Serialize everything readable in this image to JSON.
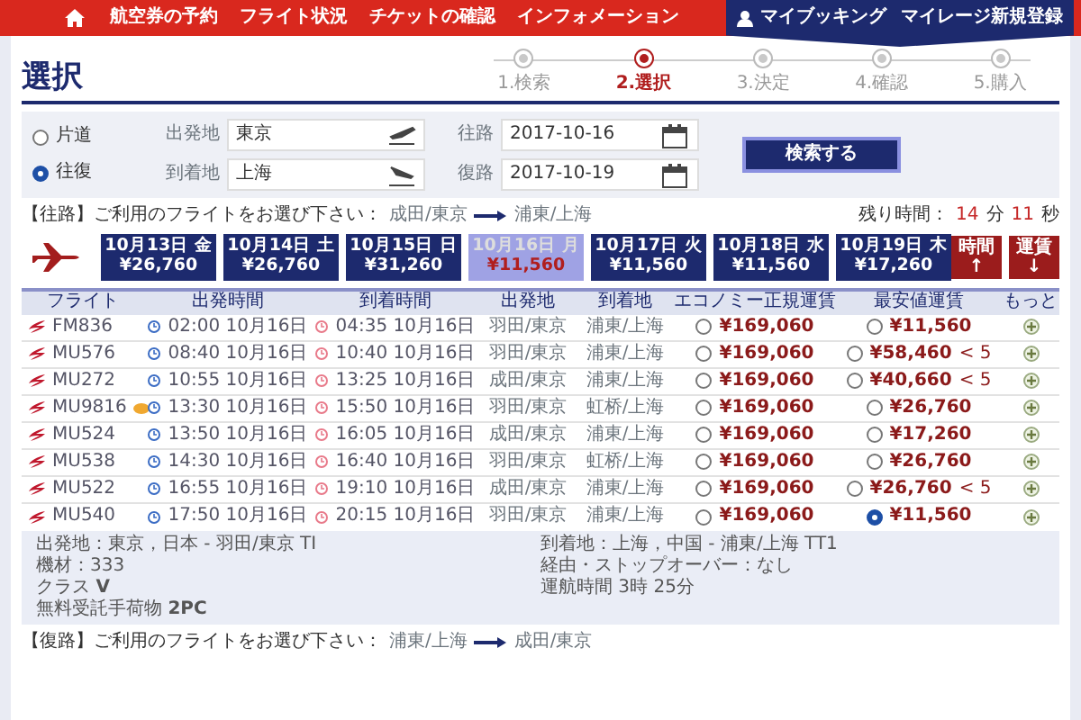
{
  "nav": {
    "items": [
      "航空券の予約",
      "フライト状況",
      "チケットの確認",
      "インフォメーション"
    ],
    "account": "マイブッキング",
    "register": "マイレージ新規登録"
  },
  "page_title": "選択",
  "steps": [
    {
      "label": "1.検索",
      "selected": false
    },
    {
      "label": "2.選択",
      "selected": true
    },
    {
      "label": "3.決定",
      "selected": false
    },
    {
      "label": "4.確認",
      "selected": false
    },
    {
      "label": "5.購入",
      "selected": false
    }
  ],
  "search": {
    "trip_types": [
      {
        "label": "片道",
        "selected": false
      },
      {
        "label": "往復",
        "selected": true
      }
    ],
    "fields": [
      {
        "label": "出発地",
        "value": "東京",
        "kind": "takeoff"
      },
      {
        "label": "往路",
        "value": "2017-10-16",
        "kind": "date"
      },
      {
        "label": "到着地",
        "value": "上海",
        "kind": "landing"
      },
      {
        "label": "復路",
        "value": "2017-10-19",
        "kind": "date"
      }
    ],
    "button": "検索する"
  },
  "outbound": {
    "prompt": "【往路】ご利用のフライトをお選び下さい：",
    "from": "成田/東京",
    "to": "浦東/上海",
    "remaining_label": "残り時間：",
    "minutes": "14",
    "minutes_unit": "分",
    "seconds": "11",
    "seconds_unit": "秒"
  },
  "date_tabs": [
    {
      "date": "10月13日 金",
      "price": "¥26,760",
      "selected": false
    },
    {
      "date": "10月14日 土",
      "price": "¥26,760",
      "selected": false
    },
    {
      "date": "10月15日 日",
      "price": "¥31,260",
      "selected": false
    },
    {
      "date": "10月16日 月",
      "price": "¥11,560",
      "selected": true
    },
    {
      "date": "10月17日 火",
      "price": "¥11,560",
      "selected": false
    },
    {
      "date": "10月18日 水",
      "price": "¥11,560",
      "selected": false
    },
    {
      "date": "10月19日 木",
      "price": "¥17,260",
      "selected": false
    }
  ],
  "sort_buttons": [
    {
      "label": "時間",
      "arrow": "↑"
    },
    {
      "label": "運賃",
      "arrow": "↓"
    }
  ],
  "columns": [
    "フライト",
    "出発時間",
    "到着時間",
    "出発地",
    "到着地",
    "エコノミー正規運賃",
    "最安値運賃",
    "もっと"
  ],
  "rows": [
    {
      "flight": "FM836",
      "badge": false,
      "departs": "02:00 10月16日",
      "arrives": "04:35 10月16日",
      "from": "羽田/東京",
      "to": "浦東/上海",
      "economy": "¥169,060",
      "economy_selected": false,
      "lowest": "¥11,560",
      "seats": "",
      "lowest_selected": false,
      "expanded": false
    },
    {
      "flight": "MU576",
      "badge": false,
      "departs": "08:40 10月16日",
      "arrives": "10:40 10月16日",
      "from": "羽田/東京",
      "to": "浦東/上海",
      "economy": "¥169,060",
      "economy_selected": false,
      "lowest": "¥58,460",
      "seats": "< 5",
      "lowest_selected": false,
      "expanded": false
    },
    {
      "flight": "MU272",
      "badge": false,
      "departs": "10:55 10月16日",
      "arrives": "13:25 10月16日",
      "from": "成田/東京",
      "to": "浦東/上海",
      "economy": "¥169,060",
      "economy_selected": false,
      "lowest": "¥40,660",
      "seats": "< 5",
      "lowest_selected": false,
      "expanded": false
    },
    {
      "flight": "MU9816",
      "badge": true,
      "departs": "13:30 10月16日",
      "arrives": "15:50 10月16日",
      "from": "羽田/東京",
      "to": "虹桥/上海",
      "economy": "¥169,060",
      "economy_selected": false,
      "lowest": "¥26,760",
      "seats": "",
      "lowest_selected": false,
      "expanded": false
    },
    {
      "flight": "MU524",
      "badge": false,
      "departs": "13:50 10月16日",
      "arrives": "16:05 10月16日",
      "from": "成田/東京",
      "to": "浦東/上海",
      "economy": "¥169,060",
      "economy_selected": false,
      "lowest": "¥17,260",
      "seats": "",
      "lowest_selected": false,
      "expanded": false
    },
    {
      "flight": "MU538",
      "badge": false,
      "departs": "14:30 10月16日",
      "arrives": "16:40 10月16日",
      "from": "羽田/東京",
      "to": "虹桥/上海",
      "economy": "¥169,060",
      "economy_selected": false,
      "lowest": "¥26,760",
      "seats": "",
      "lowest_selected": false,
      "expanded": false
    },
    {
      "flight": "MU522",
      "badge": false,
      "departs": "16:55 10月16日",
      "arrives": "19:10 10月16日",
      "from": "成田/東京",
      "to": "浦東/上海",
      "economy": "¥169,060",
      "economy_selected": false,
      "lowest": "¥26,760",
      "seats": "< 5",
      "lowest_selected": false,
      "expanded": false
    },
    {
      "flight": "MU540",
      "badge": false,
      "departs": "17:50 10月16日",
      "arrives": "20:15 10月16日",
      "from": "羽田/東京",
      "to": "浦東/上海",
      "economy": "¥169,060",
      "economy_selected": false,
      "lowest": "¥11,560",
      "seats": "",
      "lowest_selected": true,
      "expanded": true,
      "details": {
        "left": [
          "出発地：東京，日本 - 羽田/東京 TI",
          "機材：333",
          "クラス **V**",
          "無料受託手荷物 **2PC**"
        ],
        "right": [
          "到着地：上海，中国 - 浦東/上海 TT1",
          "経由・ストップオーバー：なし",
          "運航時間 3時 25分"
        ]
      }
    }
  ],
  "return": {
    "prompt": "【復路】ご利用のフライトをお選び下さい：",
    "from": "浦東/上海",
    "to": "成田/東京"
  }
}
